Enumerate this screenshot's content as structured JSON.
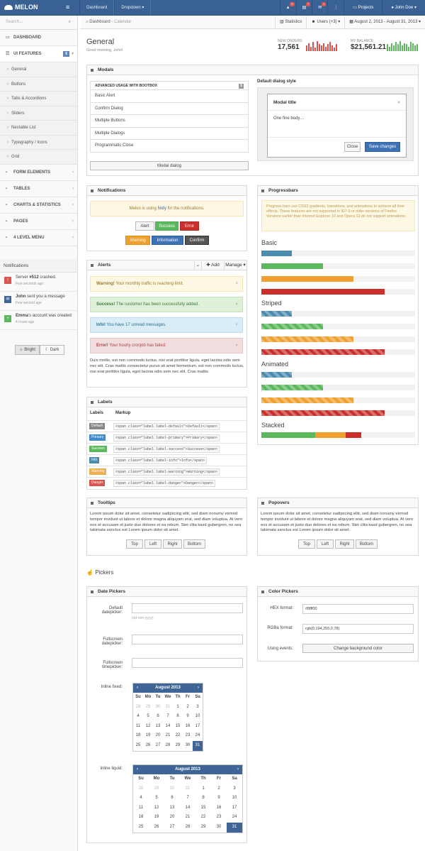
{
  "app": {
    "brand": "MELON",
    "menu_icon": "menu-icon"
  },
  "topnav": [
    "Dashboard",
    "Dropdown ▾"
  ],
  "topright": {
    "alerts_badge": "5",
    "messages_badge": "7",
    "mail_badge": "1",
    "projects": "Projects",
    "user": "John Doe ▾"
  },
  "sidebar": {
    "search_placeholder": "Search...",
    "items_top": [
      {
        "label": "DASHBOARD"
      },
      {
        "label": "UI FEATURES",
        "count": "6"
      }
    ],
    "sub": [
      "General",
      "Buttons",
      "Tabs & Accordions",
      "Sliders",
      "Nestable List",
      "Typography / Icons",
      "Grid"
    ],
    "items_bottom": [
      "FORM ELEMENTS",
      "TABLES",
      "CHARTS & STATISTICS",
      "PAGES",
      "4 LEVEL MENU"
    ],
    "notifications_title": "Notifications",
    "notifications": [
      {
        "pre": "Server ",
        "bold": "#512",
        "post": " crashed.",
        "time": "Few seconds ago",
        "color": "#d9534f",
        "icon": "!"
      },
      {
        "pre": "",
        "bold": "John",
        "post": " sent you a message",
        "time": "Few second ago",
        "color": "#3f6597",
        "icon": "✉"
      },
      {
        "pre": "",
        "bold": "Emma",
        "post": "'s account was created",
        "time": "4 hours ago",
        "color": "#5cb85c",
        "icon": "+"
      }
    ],
    "theme_bright": "☼ Bright",
    "theme_dark": "☾ Dark"
  },
  "crumbs": {
    "home": "Dashboard",
    "current": "Calendar",
    "statistics": "Statistics",
    "users": "Users (+3) ▾",
    "date_range": "August 2, 2013 - August 31, 2013 ▾"
  },
  "page": {
    "title": "General",
    "subtitle": "Good morning, John!"
  },
  "stats": [
    {
      "label": "NEW ORDERS",
      "value": "17,561",
      "color": "#d9534f"
    },
    {
      "label": "MY BALANCE",
      "value": "$21,561.21",
      "color": "#5cb85c"
    }
  ],
  "modals": {
    "title": "Modals",
    "table_header": "ADVANCED USAGE WITH BOOTBOX",
    "badge": "5",
    "rows": [
      "Basic Alert",
      "Confirm Dialog",
      "Multiple Buttons",
      "Multiple Dialogs",
      "Programmatic Close"
    ],
    "button": "Modal dialog",
    "default_title": "Default dialog style",
    "dialog_title": "Modal title",
    "dialog_body": "One fine body…",
    "close": "Close",
    "save": "Save changes"
  },
  "notifications_widget": {
    "title": "Notifications",
    "info_pre": "Melon is using ",
    "info_link": "Noty",
    "info_post": " for the notifications.",
    "buttons": [
      "Alert",
      "Success",
      "Error",
      "Warning",
      "Information",
      "Confirm"
    ]
  },
  "progress": {
    "title": "Progressbars",
    "warning": "Progress bars use CSS3 gradients, transitions, and animations to achieve all their effects. These features are not supported in IE7-9 or older versions of Firefox. Versions earlier than Internet Explorer 10 and Opera 12 do not support animations.",
    "sections": [
      "Basic",
      "Striped",
      "Animated",
      "Stacked"
    ],
    "bars": [
      {
        "color": "#4b8bb0",
        "value": 0.2
      },
      {
        "color": "#5cb85c",
        "value": 0.4
      },
      {
        "color": "#f0a030",
        "value": 0.6
      },
      {
        "color": "#c9302c",
        "value": 0.8
      }
    ],
    "stacked": [
      {
        "color": "#5cb85c",
        "value": 0.35
      },
      {
        "color": "#f0a030",
        "value": 0.2
      },
      {
        "color": "#c9302c",
        "value": 0.1
      }
    ]
  },
  "alerts": {
    "title": "Alerts",
    "add": "✚ Add",
    "manage": "Manage ▾",
    "items": [
      {
        "bold": "Warning!",
        "text": " Your monthly traffic is reaching limit.",
        "bg": "#fcf8e3",
        "bd": "#f5e5b8",
        "fg": "#a0772d"
      },
      {
        "bold": "Success!",
        "text": " The customer has been successfully added.",
        "bg": "#dff0d8",
        "bd": "#c7e2b9",
        "fg": "#3c763d"
      },
      {
        "bold": "Info!",
        "text": " You have 17 unread messages.",
        "bg": "#d9edf7",
        "bd": "#bcdceb",
        "fg": "#31708f"
      },
      {
        "bold": "Error!",
        "text": " Your hourly cronjob has failed.",
        "bg": "#f2dede",
        "bd": "#e7c6c8",
        "fg": "#a94442"
      }
    ],
    "body": "Duis mollis, est non commodo luctus, nisi erat porttitor ligula, eget lacinia odio sem nec elit. Cras mattis consectetur purus sit amet fermentum. est non commodo luctus, nisi erat porttitor ligula, eget lacinia odio sem nec elit. Cras mattis"
  },
  "labels": {
    "title": "Labels",
    "col1": "Labels",
    "col2": "Markup",
    "rows": [
      {
        "name": "Default",
        "color": "#888",
        "code": "<span class=\"label label-default\">Default</span>"
      },
      {
        "name": "Primary",
        "color": "#428bca",
        "code": "<span class=\"label label-primary\">Primary</span>"
      },
      {
        "name": "Success",
        "color": "#5cb85c",
        "code": "<span class=\"label label-success\">Success</span>"
      },
      {
        "name": "Info",
        "color": "#4b8bb0",
        "code": "<span class=\"label label-info\">Info</span>"
      },
      {
        "name": "Warning",
        "color": "#f0ad4e",
        "code": "<span class=\"label label-warning\">Warning</span>"
      },
      {
        "name": "Danger",
        "color": "#d9534f",
        "code": "<span class=\"label label-danger\">Danger</span>"
      }
    ]
  },
  "tooltips": {
    "title": "Tooltips",
    "body": "Lorem ipsum dolor sit amet, consetetur sadipscing elitr, sed diam nonumy eirmod tempor invidunt ut labore et dolore magna aliquyam erat, sed diam voluptua. At vero eos et accusam et justo duo dolores et ea rebum. Stet clita kasd gubergren, no sea takimata sanctus est Lorem ipsum dolor sit amet.",
    "buttons": [
      "Top",
      "Left",
      "Right",
      "Bottom"
    ]
  },
  "popovers": {
    "title": "Popovers",
    "body": "Lorem ipsum dolor sit amet, consetetur sadipscing elitr, sed diam nonumy eirmod tempor invidunt ut labore et dolore magna aliquyam erat, sed diam voluptua. At vero eos et accusam et justo duo dolores et ea rebum. Stet clita kasd gubergren, no sea takimata sanctus est Lorem ipsum dolor sit amet.",
    "buttons": [
      "Top",
      "Left",
      "Right",
      "Bottom"
    ]
  },
  "pickers": {
    "section": "Pickers",
    "date_title": "Date Pickers",
    "default_label": "Default datepicker:",
    "placeholder": "(dd-mm-yyyy)",
    "fullscreen_date": "Fullscreen datepicker:",
    "fullscreen_time": "Fullscreen timepicker:",
    "inline_fixed": "Inline fixed:",
    "inline_liquid": "Inline liquid:",
    "month": "August 2013",
    "weekdays": [
      "Su",
      "Mo",
      "Tu",
      "We",
      "Th",
      "Fr",
      "Sa"
    ],
    "days": [
      "28",
      "29",
      "30",
      "31",
      "1",
      "2",
      "3",
      "4",
      "5",
      "6",
      "7",
      "8",
      "9",
      "10",
      "11",
      "12",
      "13",
      "14",
      "15",
      "16",
      "17",
      "18",
      "19",
      "20",
      "21",
      "22",
      "23",
      "24",
      "25",
      "26",
      "27",
      "28",
      "29",
      "30",
      "31"
    ],
    "selected": "31",
    "color_title": "Color Pickers",
    "hex_label": "HEX format:",
    "hex_value": "#8fff00",
    "rgba_label": "RGBa format:",
    "rgba_value": "rgb(0,194,255,0.78)",
    "events_label": "Using events:",
    "change_bg": "Change background color"
  }
}
